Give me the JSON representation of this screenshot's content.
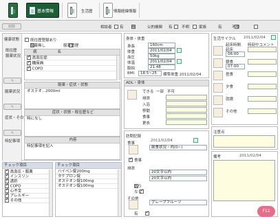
{
  "toolbar": {
    "tabs": [
      {
        "label": "基本情報"
      },
      {
        "label": "生活歴"
      },
      {
        "label": "情報経緯情報"
      }
    ]
  },
  "filter": {
    "items": [
      "相談者",
      "有",
      "無",
      "公的機関",
      "有",
      "不明",
      "家族",
      "有",
      "不明"
    ]
  },
  "left": {
    "button_label": "削除",
    "section1": {
      "title": "健康状態",
      "label1": "既往歴",
      "label2": "服薬状況",
      "cb_items": [
        "服薬状況",
        "服薬管理"
      ],
      "options": [
        "既往歴登録あり",
        "服薬無し"
      ]
    },
    "table1": {
      "head": [
        "病",
        "名"
      ],
      "rows": [
        "高血圧症",
        "糖尿病",
        "COPD"
      ]
    },
    "label_med": "服薬状況",
    "sub1": {
      "title": "服薬・症状・状態",
      "text": "オステオ...2000ml"
    },
    "label_sym": "症状・その他",
    "sub2": {
      "title": "症状・状態・既往歴など",
      "text": "特になし"
    },
    "label_rem": "特記事項",
    "sub3": {
      "title": "内容",
      "text": "特記事項を記入"
    },
    "check_title": "チェック項目",
    "check_items": [
      "高血圧・服薬",
      "インスリン",
      "透析",
      "COPD",
      "心不全",
      "アレルギー",
      "その他"
    ],
    "med_title": "チェック項目",
    "meds": [
      "ハイペン錠200mg",
      "タケプロン錠",
      "オステオン錠100mg",
      "オステオン錠100mg"
    ]
  },
  "mid": {
    "sec1_title": "身体・体重",
    "rows": [
      {
        "label": "身長",
        "value": "160cm"
      },
      {
        "label": "体重",
        "value": "2011/02/04"
      },
      {
        "label": "血圧",
        "value": "50kg"
      },
      {
        "label": "体温",
        "value": "2011/02/04"
      },
      {
        "label": "脈拍",
        "value": "21.48"
      }
    ],
    "bmi_label": "BMI",
    "bmi_value": "18.5~25",
    "bmi2": "標準体重 2011/02/04",
    "sec2_title": "ADL・身体",
    "sec2_rows": [
      "排泄",
      "入浴",
      "移動",
      "食事",
      "更衣"
    ],
    "sec2_hdr": [
      "できる",
      "一部",
      "不可"
    ],
    "sec3_title": "訪問記録",
    "sec3_date": "2011/02/04",
    "sec3_items": [
      {
        "label": "食事",
        "text": "飲食状況・内(0~)"
      },
      {
        "label": "排泄",
        "text": "20文字以内"
      },
      {
        "label": "入浴",
        "text": "20文字以内"
      },
      {
        "label": "その他",
        "text": "グレープフルーツ"
      }
    ],
    "sec3_cbs": [
      "食事",
      "あり",
      "なし",
      "有"
    ]
  },
  "right": {
    "sec1_title": "生活サイクル",
    "sec1_date": "2011/02/04",
    "sec1_hdr": [
      "起床時間",
      "時刻やコメント"
    ],
    "sec1_rows": [
      {
        "label": "起床",
        "value": "06:00"
      },
      {
        "label": "朝食",
        "value": "07:00"
      },
      {
        "label": "昼食",
        "value": ""
      },
      {
        "label": "夕食",
        "value": ""
      },
      {
        "label": "就寝",
        "value": ""
      },
      {
        "label": "その他",
        "value": ""
      }
    ],
    "sec2_title": "注意点",
    "sec3_title": "備考",
    "sec3_date": "2011/02/04"
  },
  "f12": "F12"
}
